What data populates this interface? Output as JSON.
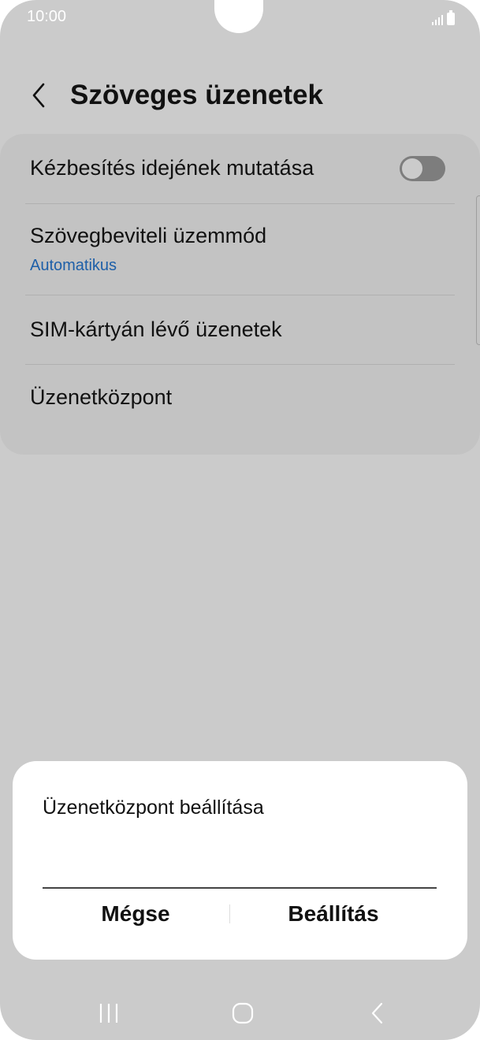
{
  "status_bar": {
    "time": "10:00"
  },
  "header": {
    "title": "Szöveges üzenetek",
    "back_icon": "chevron-left-icon"
  },
  "settings": {
    "items": [
      {
        "label": "Kézbesítés idejének mutatása",
        "toggle": "off"
      },
      {
        "label": "Szövegbeviteli üzemmód",
        "value": "Automatikus"
      },
      {
        "label": "SIM-kártyán lévő üzenetek"
      },
      {
        "label": "Üzenetközpont"
      }
    ]
  },
  "dialog": {
    "title": "Üzenetközpont beállítása",
    "input_value": "",
    "cancel_label": "Mégse",
    "confirm_label": "Beállítás"
  },
  "nav_bar": {
    "icons": [
      "recent-apps-icon",
      "home-icon",
      "back-icon"
    ]
  },
  "colors": {
    "background_dimmed": "#cbcbcb",
    "accent_blue": "#1d5fa8",
    "dialog_bg": "#ffffff"
  }
}
